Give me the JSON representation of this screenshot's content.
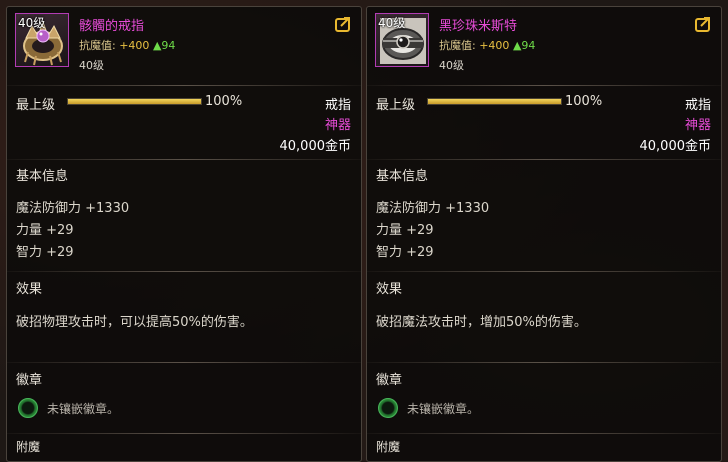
{
  "cards": [
    {
      "level_badge": "40级",
      "name": "骸髑的戒指",
      "stat_label": "抗魔值:",
      "stat_plus": "+400",
      "stat_up": "▲94",
      "level_text": "40级",
      "grade_label": "最上级",
      "grade_percent": "100%",
      "grade_value": 1.0,
      "item_type": "戒指",
      "rarity": "神器",
      "price": "40,000金币",
      "basic_info_title": "基本信息",
      "attributes": [
        "魔法防御力 +1330",
        "力量 +29",
        "智力 +29"
      ],
      "effect_title": "效果",
      "effect_text": "破招物理攻击时，可以提高50%的伤害。",
      "emblem_title": "徽章",
      "emblem_text": "未镶嵌徽章。",
      "enchant_title": "附魔",
      "icon": "skull-ring-icon"
    },
    {
      "level_badge": "40级",
      "name": "黑珍珠米斯特",
      "stat_label": "抗魔值:",
      "stat_plus": "+400",
      "stat_up": "▲94",
      "level_text": "40级",
      "grade_label": "最上级",
      "grade_percent": "100%",
      "grade_value": 1.0,
      "item_type": "戒指",
      "rarity": "神器",
      "price": "40,000金币",
      "basic_info_title": "基本信息",
      "attributes": [
        "魔法防御力 +1330",
        "力量 +29",
        "智力 +29"
      ],
      "effect_title": "效果",
      "effect_text": "破招魔法攻击时，增加50%的伤害。",
      "emblem_title": "徽章",
      "emblem_text": "未镶嵌徽章。",
      "enchant_title": "附魔",
      "icon": "pearl-ring-icon"
    }
  ],
  "colors": {
    "rarity": "#e64bd6",
    "stat_plus": "#e8c042",
    "stat_up": "#6fdc4a",
    "grade_bar": "#e2bd45",
    "share_icon": "#e8b830",
    "emblem_ring": "#2c8f39"
  },
  "share_icon": "share-icon"
}
